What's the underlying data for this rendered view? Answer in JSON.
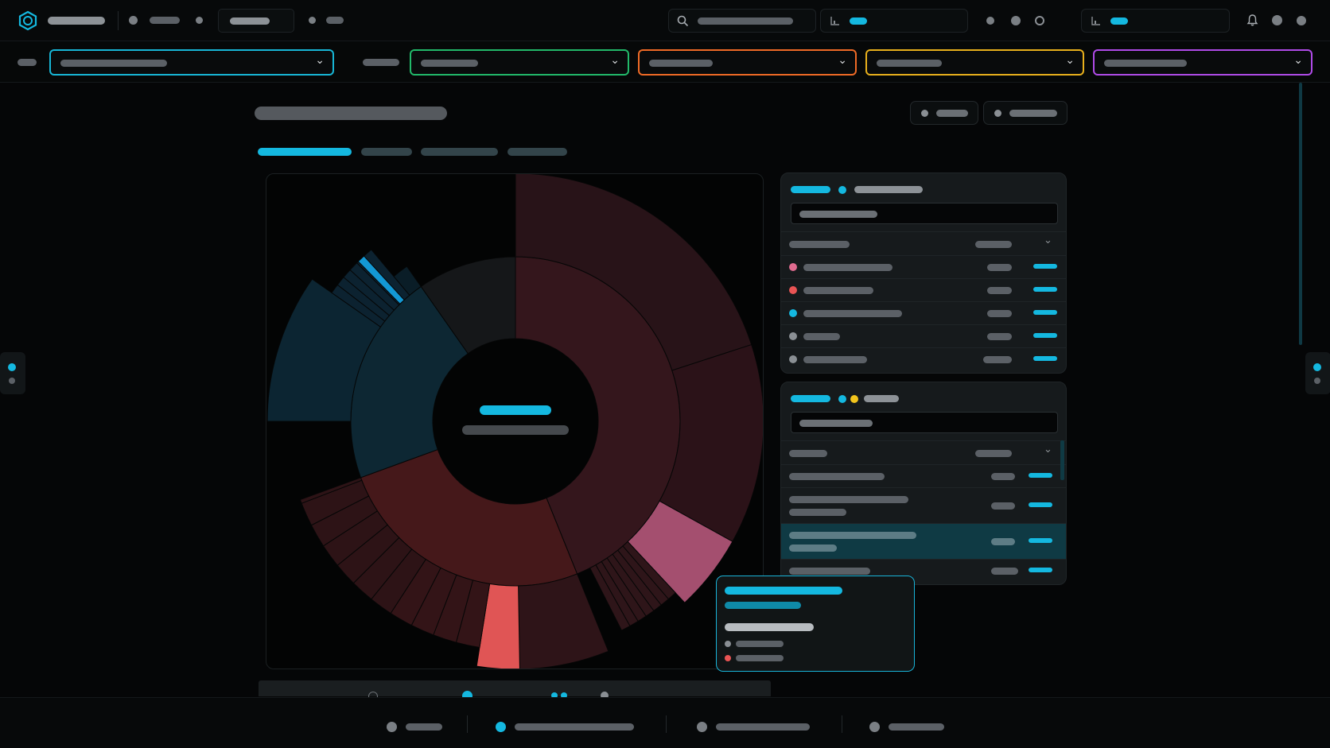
{
  "app": {
    "title": ""
  },
  "colors": {
    "accent": "#14b8e0",
    "filter_cyan": "#17b6d6",
    "filter_green": "#22b96a",
    "filter_orange": "#ef6a26",
    "filter_yellow": "#e8b01c",
    "filter_purple": "#b04be8",
    "pink": "#e06b8f",
    "red": "#e95454",
    "yellow": "#f2c41c",
    "gray": "#8a8f94"
  },
  "icons": {
    "logo": "hexagon-logo-icon",
    "search": "search-icon",
    "chart": "chart-icon",
    "bell": "bell-icon",
    "chevron": "chevron-down-icon"
  },
  "glyphs": {
    "chevron": "⌄"
  },
  "chart_data": {
    "type": "sunburst",
    "title": "",
    "rings": 2
  }
}
